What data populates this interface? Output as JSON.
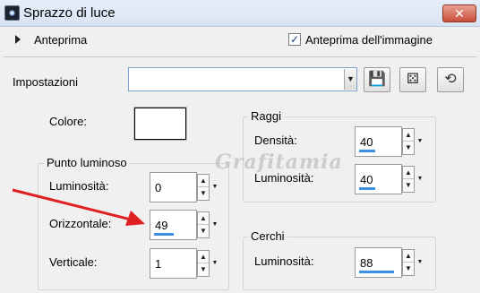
{
  "window": {
    "title": "Sprazzo di luce",
    "close_glyph": "✕"
  },
  "preview": {
    "label": "Anteprima",
    "image_preview_label": "Anteprima dell'immagine",
    "image_preview_checked": true
  },
  "settings": {
    "label": "Impostazioni",
    "value": "",
    "buttons": [
      "save-preset-icon",
      "randomize-dice-icon",
      "reset-settings-icon"
    ]
  },
  "color": {
    "label": "Colore:",
    "value": "#ffffff"
  },
  "bright_spot": {
    "title": "Punto luminoso",
    "brightness": {
      "label": "Luminosità:",
      "value": "0",
      "fill": 0.0
    },
    "horizontal": {
      "label": "Orizzontale:",
      "value": "49",
      "fill": 0.49
    },
    "vertical": {
      "label": "Verticale:",
      "value": "1",
      "fill": 0.01
    }
  },
  "rays": {
    "title": "Raggi",
    "density": {
      "label": "Densità:",
      "value": "40",
      "fill": 0.4
    },
    "brightness": {
      "label": "Luminosità:",
      "value": "40",
      "fill": 0.4
    }
  },
  "circles": {
    "title": "Cerchi",
    "brightness": {
      "label": "Luminosità:",
      "value": "88",
      "fill": 0.88
    }
  },
  "watermark": {
    "text": "Grafitamia"
  },
  "annotation_arrow_color": "#e02020"
}
